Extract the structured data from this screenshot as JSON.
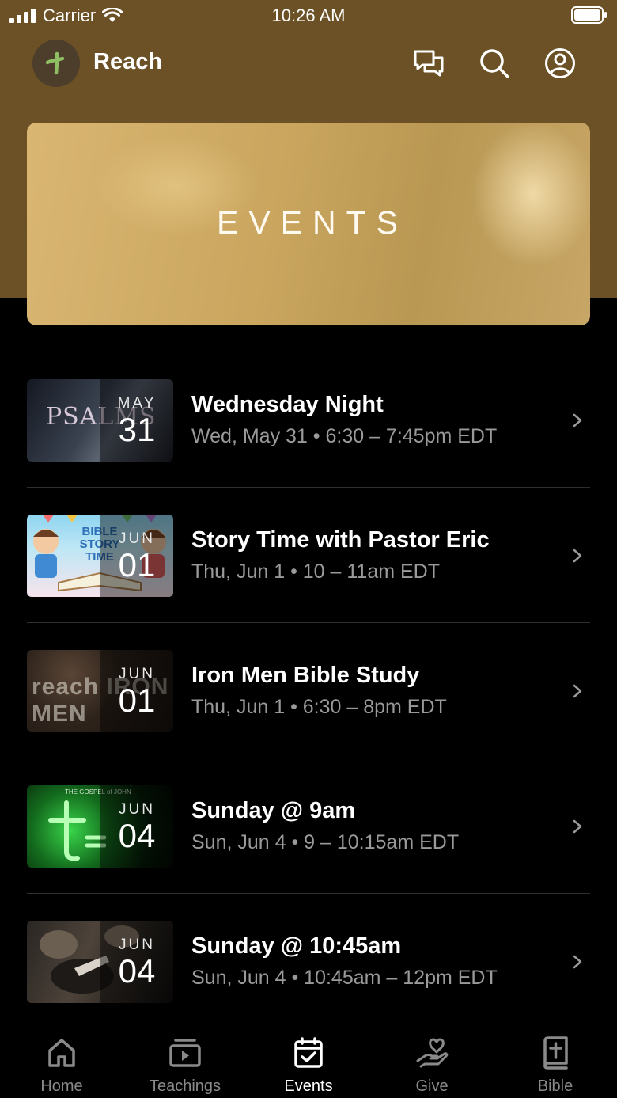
{
  "status_bar": {
    "carrier": "Carrier",
    "time": "10:26 AM"
  },
  "header": {
    "app_name": "Reach",
    "icons": [
      "chat-icon",
      "search-icon",
      "account-icon"
    ]
  },
  "banner": {
    "title": "EVENTS"
  },
  "events": [
    {
      "title": "Wednesday Night",
      "subtitle": "Wed, May 31 • 6:30 – 7:45pm EDT",
      "month": "MAY",
      "day": "31",
      "thumb_text": "PSALMS"
    },
    {
      "title": "Story Time with Pastor Eric",
      "subtitle": "Thu, Jun 1 • 10 – 11am EDT",
      "month": "JUN",
      "day": "01",
      "thumb_text": "BIBLE STORY TIME"
    },
    {
      "title": "Iron Men Bible Study",
      "subtitle": "Thu, Jun 1 • 6:30 – 8pm EDT",
      "month": "JUN",
      "day": "01",
      "thumb_text": "reach IRON MEN"
    },
    {
      "title": "Sunday @ 9am",
      "subtitle": "Sun, Jun 4 • 9 – 10:15am EDT",
      "month": "JUN",
      "day": "04",
      "thumb_text": "THE GOSPEL of JOHN"
    },
    {
      "title": "Sunday @ 10:45am",
      "subtitle": "Sun, Jun 4 • 10:45am – 12pm EDT",
      "month": "JUN",
      "day": "04",
      "thumb_text": ""
    }
  ],
  "tabs": [
    {
      "label": "Home",
      "icon": "home-icon",
      "active": false
    },
    {
      "label": "Teachings",
      "icon": "play-icon",
      "active": false
    },
    {
      "label": "Events",
      "icon": "calendar-icon",
      "active": true
    },
    {
      "label": "Give",
      "icon": "give-icon",
      "active": false
    },
    {
      "label": "Bible",
      "icon": "bible-icon",
      "active": false
    }
  ],
  "colors": {
    "header_bg": "#6b5125",
    "background": "#000000",
    "inactive_tab": "#8a8a8a",
    "subtitle": "#9a9a9a"
  }
}
